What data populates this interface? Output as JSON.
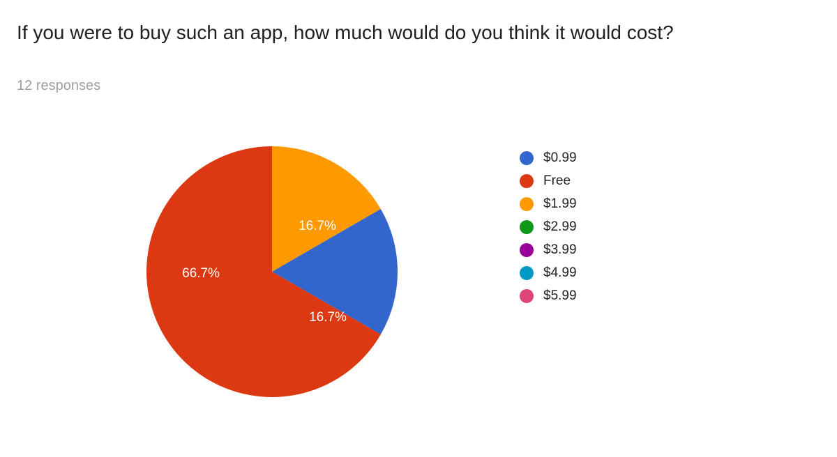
{
  "title": "If you were to buy such an app, how much would do you think it would cost?",
  "subtitle": "12 responses",
  "chart_data": {
    "type": "pie",
    "title": "If you were to buy such an app, how much would do you think it would cost?",
    "total_responses": 12,
    "series": [
      {
        "name": "$0.99",
        "value": 16.7,
        "color": "#3366cc"
      },
      {
        "name": "Free",
        "value": 66.7,
        "color": "#dc3912"
      },
      {
        "name": "$1.99",
        "value": 16.7,
        "color": "#ff9900"
      },
      {
        "name": "$2.99",
        "value": 0,
        "color": "#109618"
      },
      {
        "name": "$3.99",
        "value": 0,
        "color": "#990099"
      },
      {
        "name": "$4.99",
        "value": 0,
        "color": "#0099c6"
      },
      {
        "name": "$5.99",
        "value": 0,
        "color": "#dd4477"
      }
    ],
    "slice_labels": {
      "orange": "16.7%",
      "blue": "16.7%",
      "red": "66.7%"
    }
  }
}
